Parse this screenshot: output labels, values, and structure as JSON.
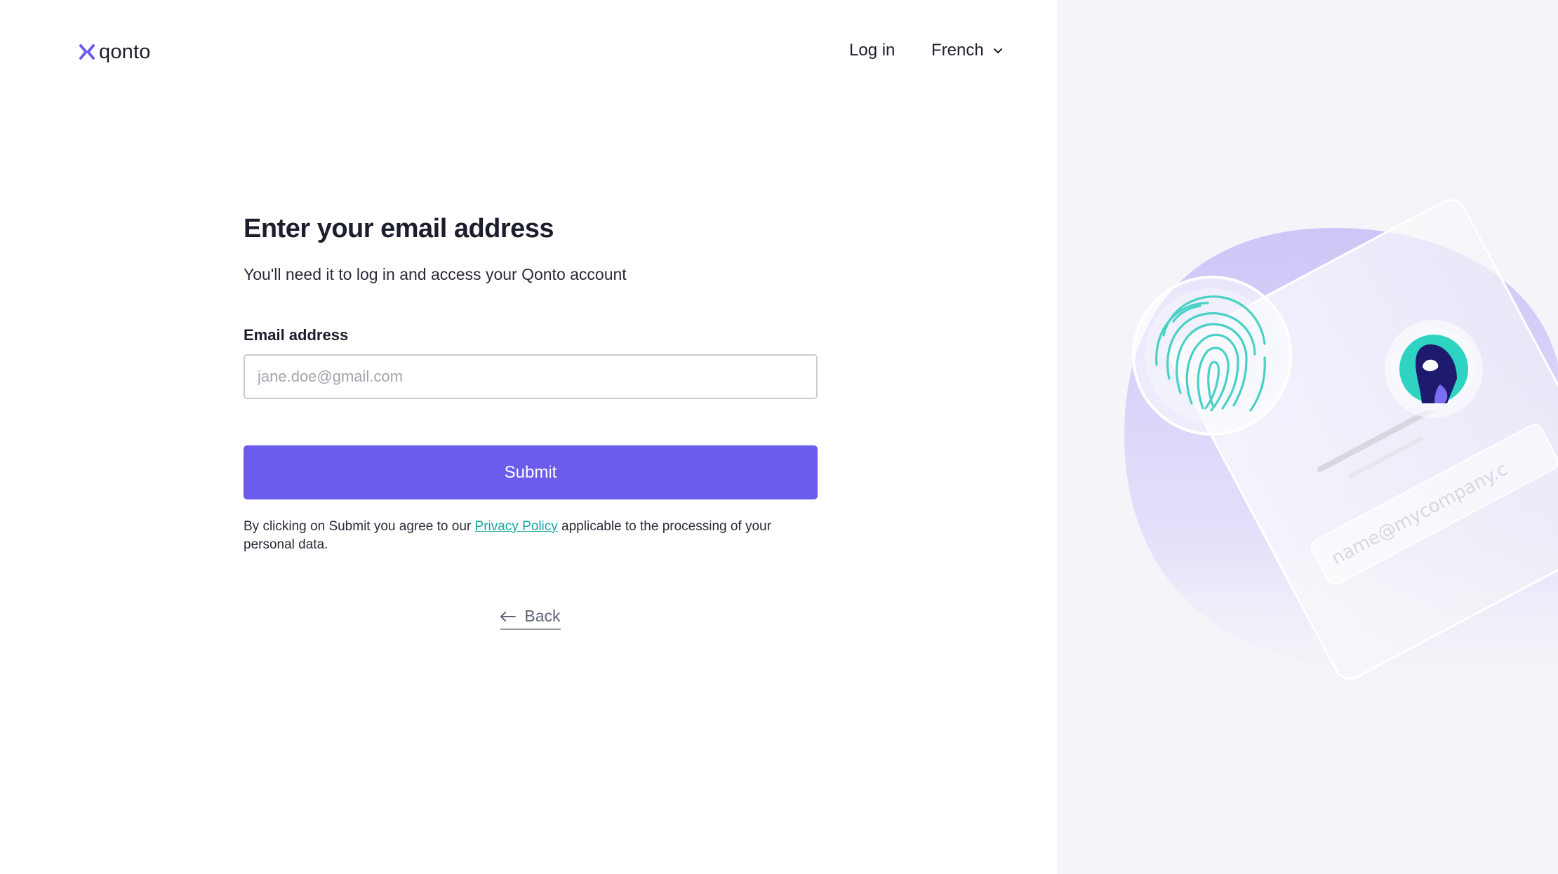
{
  "header": {
    "brand": "qonto",
    "login_label": "Log in",
    "language_label": "French"
  },
  "form": {
    "title": "Enter your email address",
    "subtitle": "You'll need it to log in and access your Qonto account",
    "email_label": "Email address",
    "email_placeholder": "jane.doe@gmail.com",
    "email_value": "",
    "submit_label": "Submit",
    "legal_prefix": "By clicking on Submit you agree to our ",
    "legal_link": "Privacy Policy",
    "legal_suffix": " applicable to the processing of your personal data.",
    "back_label": "Back"
  },
  "illustration": {
    "card_email_text": "name@mycompany.c"
  },
  "colors": {
    "accent": "#6b5ced",
    "link": "#18a8a0",
    "right_panel_bg": "#f4f5f9",
    "fingerprint": "#48d1c4",
    "avatar_teal": "#2fd3c1",
    "avatar_navy": "#1e1b6e"
  },
  "icons": {
    "logo": "qonto-x-mark-icon",
    "language_toggle": "chevron-down-icon",
    "back": "arrow-left-icon",
    "fingerprint": "fingerprint-icon"
  }
}
